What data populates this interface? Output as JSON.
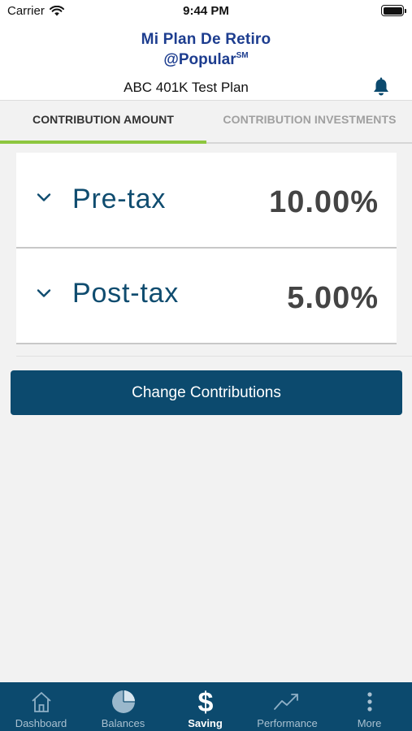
{
  "status_bar": {
    "carrier": "Carrier",
    "time": "9:44 PM"
  },
  "header": {
    "logo_line1": "Mi Plan De Retiro",
    "logo_line2": "@Popular",
    "logo_mark": "SM",
    "plan_name": "ABC 401K Test Plan",
    "notification_icon": "bell-icon"
  },
  "tabs": [
    {
      "label": "CONTRIBUTION AMOUNT",
      "active": true
    },
    {
      "label": "CONTRIBUTION INVESTMENTS",
      "active": false
    }
  ],
  "contributions": [
    {
      "label": "Pre-tax",
      "value": "10.00%",
      "icon": "chevron-down-icon"
    },
    {
      "label": "Post-tax",
      "value": "5.00%",
      "icon": "chevron-down-icon"
    }
  ],
  "actions": {
    "change_label": "Change Contributions"
  },
  "bottom_nav": [
    {
      "label": "Dashboard",
      "icon": "home-icon",
      "active": false
    },
    {
      "label": "Balances",
      "icon": "pie-chart-icon",
      "active": false
    },
    {
      "label": "Saving",
      "icon": "dollar-icon",
      "active": true
    },
    {
      "label": "Performance",
      "icon": "trend-icon",
      "active": false
    },
    {
      "label": "More",
      "icon": "more-vertical-icon",
      "active": false
    }
  ],
  "colors": {
    "brand_navy": "#0c4a6e",
    "logo_blue": "#1d3d8f",
    "tab_accent": "#8dc63f",
    "label_blue": "#0f4c6f"
  }
}
